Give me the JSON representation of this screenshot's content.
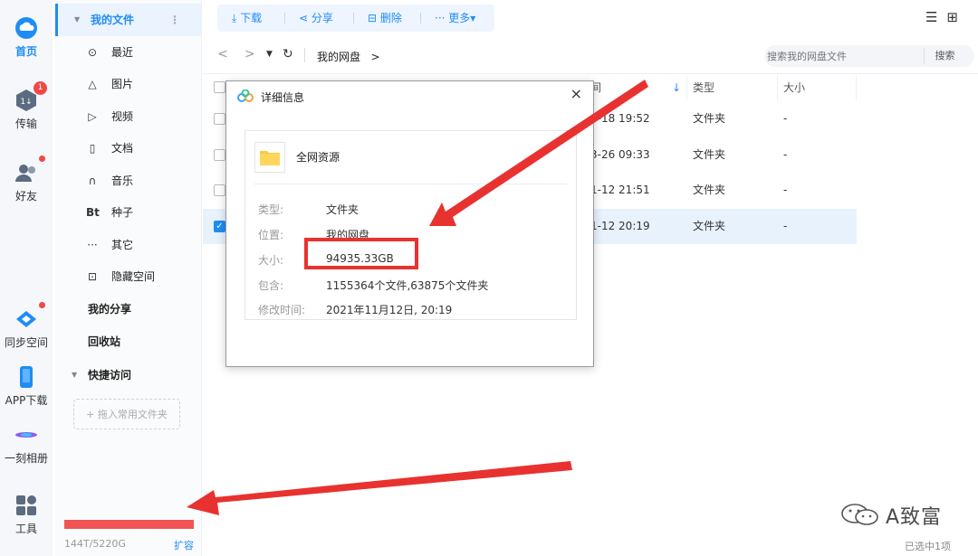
{
  "rail": {
    "items": [
      {
        "label": "首页",
        "icon": "cloud-icon"
      },
      {
        "label": "传输",
        "icon": "transfer-icon",
        "badge": "1"
      },
      {
        "label": "好友",
        "icon": "friends-icon"
      },
      {
        "label": "同步空间",
        "icon": "sync-icon"
      },
      {
        "label": "APP下载",
        "icon": "phone-icon"
      },
      {
        "label": "一刻相册",
        "icon": "album-icon"
      },
      {
        "label": "工具",
        "icon": "tools-icon"
      }
    ]
  },
  "sidebar": {
    "my_files": "我的文件",
    "items": [
      {
        "label": "最近",
        "icon": "⊙"
      },
      {
        "label": "图片",
        "icon": "△"
      },
      {
        "label": "视频",
        "icon": "▷"
      },
      {
        "label": "文档",
        "icon": "▯"
      },
      {
        "label": "音乐",
        "icon": "∩"
      },
      {
        "label": "种子",
        "icon": "Bt"
      },
      {
        "label": "其它",
        "icon": "···"
      },
      {
        "label": "隐藏空间",
        "icon": "⊡"
      }
    ],
    "my_share": "我的分享",
    "recycle": "回收站",
    "quick_access": "快捷访问",
    "quick_add": "+ 拖入常用文件夹",
    "storage": "144T/5220G",
    "expand": "扩容"
  },
  "toolbar": {
    "download": "下载",
    "share": "分享",
    "delete": "删除",
    "more": "··· 更多▾"
  },
  "nav": {
    "breadcrumb": "我的网盘",
    "breadcrumb_arrow": ">",
    "search_placeholder": "搜索我的网盘文件",
    "search_button": "搜索"
  },
  "table": {
    "headers": {
      "date": "间",
      "type": "类型",
      "size": "大小"
    },
    "rows": [
      {
        "date": "4-18 19:52",
        "type": "文件夹",
        "size": "-",
        "checked": false
      },
      {
        "date": "3-26 09:33",
        "type": "文件夹",
        "size": "-",
        "checked": false
      },
      {
        "date": "1-12 21:51",
        "type": "文件夹",
        "size": "-",
        "checked": false
      },
      {
        "date": "1-12 20:19",
        "type": "文件夹",
        "size": "-",
        "checked": true
      }
    ]
  },
  "dialog": {
    "title": "详细信息",
    "close": "×",
    "name": "全网资源",
    "props": [
      {
        "key": "类型:",
        "value": "文件夹"
      },
      {
        "key": "位置:",
        "value": "我的网盘"
      },
      {
        "key": "大小:",
        "value": "94935.33GB"
      },
      {
        "key": "包含:",
        "value": "1155364个文件,63875个文件夹"
      },
      {
        "key": "修改时间:",
        "value": "2021年11月12日, 20:19"
      }
    ]
  },
  "status": "已选中1项",
  "watermark": "A致富",
  "colors": {
    "accent": "#1f8cf5",
    "annotation": "#e8322f",
    "badge": "#f04848"
  }
}
